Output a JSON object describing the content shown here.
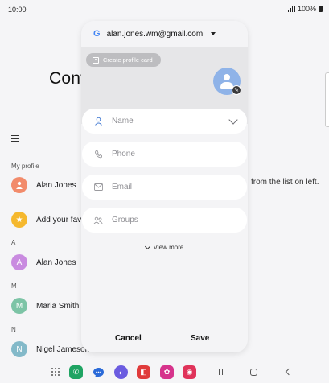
{
  "status_bar": {
    "time": "10:00",
    "battery": "100%"
  },
  "background": {
    "title": "Cont",
    "sections": {
      "my_profile": "My profile",
      "a": "A",
      "m": "M",
      "n": "N"
    },
    "contacts": [
      {
        "name": "Alan Jones",
        "color": "#f28b6b"
      },
      {
        "name": "Add your fav",
        "color": "#f5b82e"
      },
      {
        "name": "Alan Jones",
        "initial": "A",
        "color": "#c98be0"
      },
      {
        "name": "Maria Smith",
        "initial": "M",
        "color": "#7dc4a6"
      },
      {
        "name": "Nigel Jameson",
        "initial": "N",
        "color": "#83b9c9"
      }
    ],
    "right_panel_text": "from the list on left."
  },
  "dialog": {
    "account_email": "alan.jones.wm@gmail.com",
    "create_profile_card": "Create profile card",
    "fields": {
      "name": "Name",
      "phone": "Phone",
      "email": "Email",
      "groups": "Groups"
    },
    "view_more": "View more",
    "cancel": "Cancel",
    "save": "Save"
  },
  "colors": {
    "accent": "#8fb3e8",
    "dialog_bg": "#f4f4f6"
  }
}
